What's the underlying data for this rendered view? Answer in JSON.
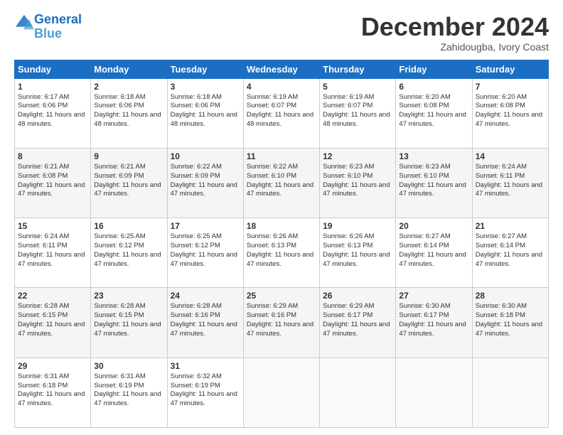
{
  "logo": {
    "line1": "General",
    "line2": "Blue"
  },
  "header": {
    "month": "December 2024",
    "location": "Zahidougba, Ivory Coast"
  },
  "days": [
    "Sunday",
    "Monday",
    "Tuesday",
    "Wednesday",
    "Thursday",
    "Friday",
    "Saturday"
  ],
  "weeks": [
    [
      {
        "day": "1",
        "sunrise": "6:17 AM",
        "sunset": "6:06 PM",
        "daylight": "11 hours and 48 minutes."
      },
      {
        "day": "2",
        "sunrise": "6:18 AM",
        "sunset": "6:06 PM",
        "daylight": "11 hours and 48 minutes."
      },
      {
        "day": "3",
        "sunrise": "6:18 AM",
        "sunset": "6:06 PM",
        "daylight": "11 hours and 48 minutes."
      },
      {
        "day": "4",
        "sunrise": "6:19 AM",
        "sunset": "6:07 PM",
        "daylight": "11 hours and 48 minutes."
      },
      {
        "day": "5",
        "sunrise": "6:19 AM",
        "sunset": "6:07 PM",
        "daylight": "11 hours and 48 minutes."
      },
      {
        "day": "6",
        "sunrise": "6:20 AM",
        "sunset": "6:08 PM",
        "daylight": "11 hours and 47 minutes."
      },
      {
        "day": "7",
        "sunrise": "6:20 AM",
        "sunset": "6:08 PM",
        "daylight": "11 hours and 47 minutes."
      }
    ],
    [
      {
        "day": "8",
        "sunrise": "6:21 AM",
        "sunset": "6:08 PM",
        "daylight": "11 hours and 47 minutes."
      },
      {
        "day": "9",
        "sunrise": "6:21 AM",
        "sunset": "6:09 PM",
        "daylight": "11 hours and 47 minutes."
      },
      {
        "day": "10",
        "sunrise": "6:22 AM",
        "sunset": "6:09 PM",
        "daylight": "11 hours and 47 minutes."
      },
      {
        "day": "11",
        "sunrise": "6:22 AM",
        "sunset": "6:10 PM",
        "daylight": "11 hours and 47 minutes."
      },
      {
        "day": "12",
        "sunrise": "6:23 AM",
        "sunset": "6:10 PM",
        "daylight": "11 hours and 47 minutes."
      },
      {
        "day": "13",
        "sunrise": "6:23 AM",
        "sunset": "6:10 PM",
        "daylight": "11 hours and 47 minutes."
      },
      {
        "day": "14",
        "sunrise": "6:24 AM",
        "sunset": "6:11 PM",
        "daylight": "11 hours and 47 minutes."
      }
    ],
    [
      {
        "day": "15",
        "sunrise": "6:24 AM",
        "sunset": "6:11 PM",
        "daylight": "11 hours and 47 minutes."
      },
      {
        "day": "16",
        "sunrise": "6:25 AM",
        "sunset": "6:12 PM",
        "daylight": "11 hours and 47 minutes."
      },
      {
        "day": "17",
        "sunrise": "6:25 AM",
        "sunset": "6:12 PM",
        "daylight": "11 hours and 47 minutes."
      },
      {
        "day": "18",
        "sunrise": "6:26 AM",
        "sunset": "6:13 PM",
        "daylight": "11 hours and 47 minutes."
      },
      {
        "day": "19",
        "sunrise": "6:26 AM",
        "sunset": "6:13 PM",
        "daylight": "11 hours and 47 minutes."
      },
      {
        "day": "20",
        "sunrise": "6:27 AM",
        "sunset": "6:14 PM",
        "daylight": "11 hours and 47 minutes."
      },
      {
        "day": "21",
        "sunrise": "6:27 AM",
        "sunset": "6:14 PM",
        "daylight": "11 hours and 47 minutes."
      }
    ],
    [
      {
        "day": "22",
        "sunrise": "6:28 AM",
        "sunset": "6:15 PM",
        "daylight": "11 hours and 47 minutes."
      },
      {
        "day": "23",
        "sunrise": "6:28 AM",
        "sunset": "6:15 PM",
        "daylight": "11 hours and 47 minutes."
      },
      {
        "day": "24",
        "sunrise": "6:28 AM",
        "sunset": "6:16 PM",
        "daylight": "11 hours and 47 minutes."
      },
      {
        "day": "25",
        "sunrise": "6:29 AM",
        "sunset": "6:16 PM",
        "daylight": "11 hours and 47 minutes."
      },
      {
        "day": "26",
        "sunrise": "6:29 AM",
        "sunset": "6:17 PM",
        "daylight": "11 hours and 47 minutes."
      },
      {
        "day": "27",
        "sunrise": "6:30 AM",
        "sunset": "6:17 PM",
        "daylight": "11 hours and 47 minutes."
      },
      {
        "day": "28",
        "sunrise": "6:30 AM",
        "sunset": "6:18 PM",
        "daylight": "11 hours and 47 minutes."
      }
    ],
    [
      {
        "day": "29",
        "sunrise": "6:31 AM",
        "sunset": "6:18 PM",
        "daylight": "11 hours and 47 minutes."
      },
      {
        "day": "30",
        "sunrise": "6:31 AM",
        "sunset": "6:19 PM",
        "daylight": "11 hours and 47 minutes."
      },
      {
        "day": "31",
        "sunrise": "6:32 AM",
        "sunset": "6:19 PM",
        "daylight": "11 hours and 47 minutes."
      },
      null,
      null,
      null,
      null
    ]
  ]
}
